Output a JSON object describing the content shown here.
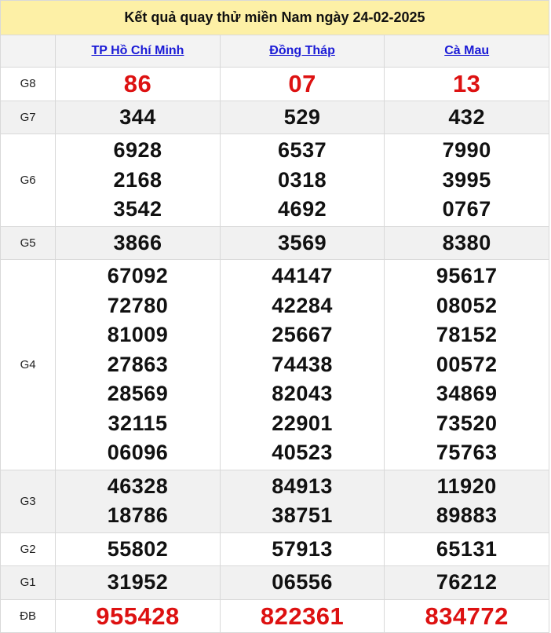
{
  "title": "Kết quả quay thử miền Nam ngày 24-02-2025",
  "provinces": [
    "TP Hồ Chí Minh",
    "Đồng Tháp",
    "Cà Mau"
  ],
  "colors": {
    "header_bg": "#fdf0a6",
    "link": "#1a1ad6",
    "highlight": "#dd1111",
    "alt_row": "#f1f1f1"
  },
  "prizes": [
    {
      "label": "G8",
      "values": [
        [
          "86"
        ],
        [
          "07"
        ],
        [
          "13"
        ]
      ]
    },
    {
      "label": "G7",
      "values": [
        [
          "344"
        ],
        [
          "529"
        ],
        [
          "432"
        ]
      ]
    },
    {
      "label": "G6",
      "values": [
        [
          "6928",
          "2168",
          "3542"
        ],
        [
          "6537",
          "0318",
          "4692"
        ],
        [
          "7990",
          "3995",
          "0767"
        ]
      ]
    },
    {
      "label": "G5",
      "values": [
        [
          "3866"
        ],
        [
          "3569"
        ],
        [
          "8380"
        ]
      ]
    },
    {
      "label": "G4",
      "values": [
        [
          "67092",
          "72780",
          "81009",
          "27863",
          "28569",
          "32115",
          "06096"
        ],
        [
          "44147",
          "42284",
          "25667",
          "74438",
          "82043",
          "22901",
          "40523"
        ],
        [
          "95617",
          "08052",
          "78152",
          "00572",
          "34869",
          "73520",
          "75763"
        ]
      ]
    },
    {
      "label": "G3",
      "values": [
        [
          "46328",
          "18786"
        ],
        [
          "84913",
          "38751"
        ],
        [
          "11920",
          "89883"
        ]
      ]
    },
    {
      "label": "G2",
      "values": [
        [
          "55802"
        ],
        [
          "57913"
        ],
        [
          "65131"
        ]
      ]
    },
    {
      "label": "G1",
      "values": [
        [
          "31952"
        ],
        [
          "06556"
        ],
        [
          "76212"
        ]
      ]
    },
    {
      "label": "ĐB",
      "values": [
        [
          "955428"
        ],
        [
          "822361"
        ],
        [
          "834772"
        ]
      ]
    }
  ]
}
